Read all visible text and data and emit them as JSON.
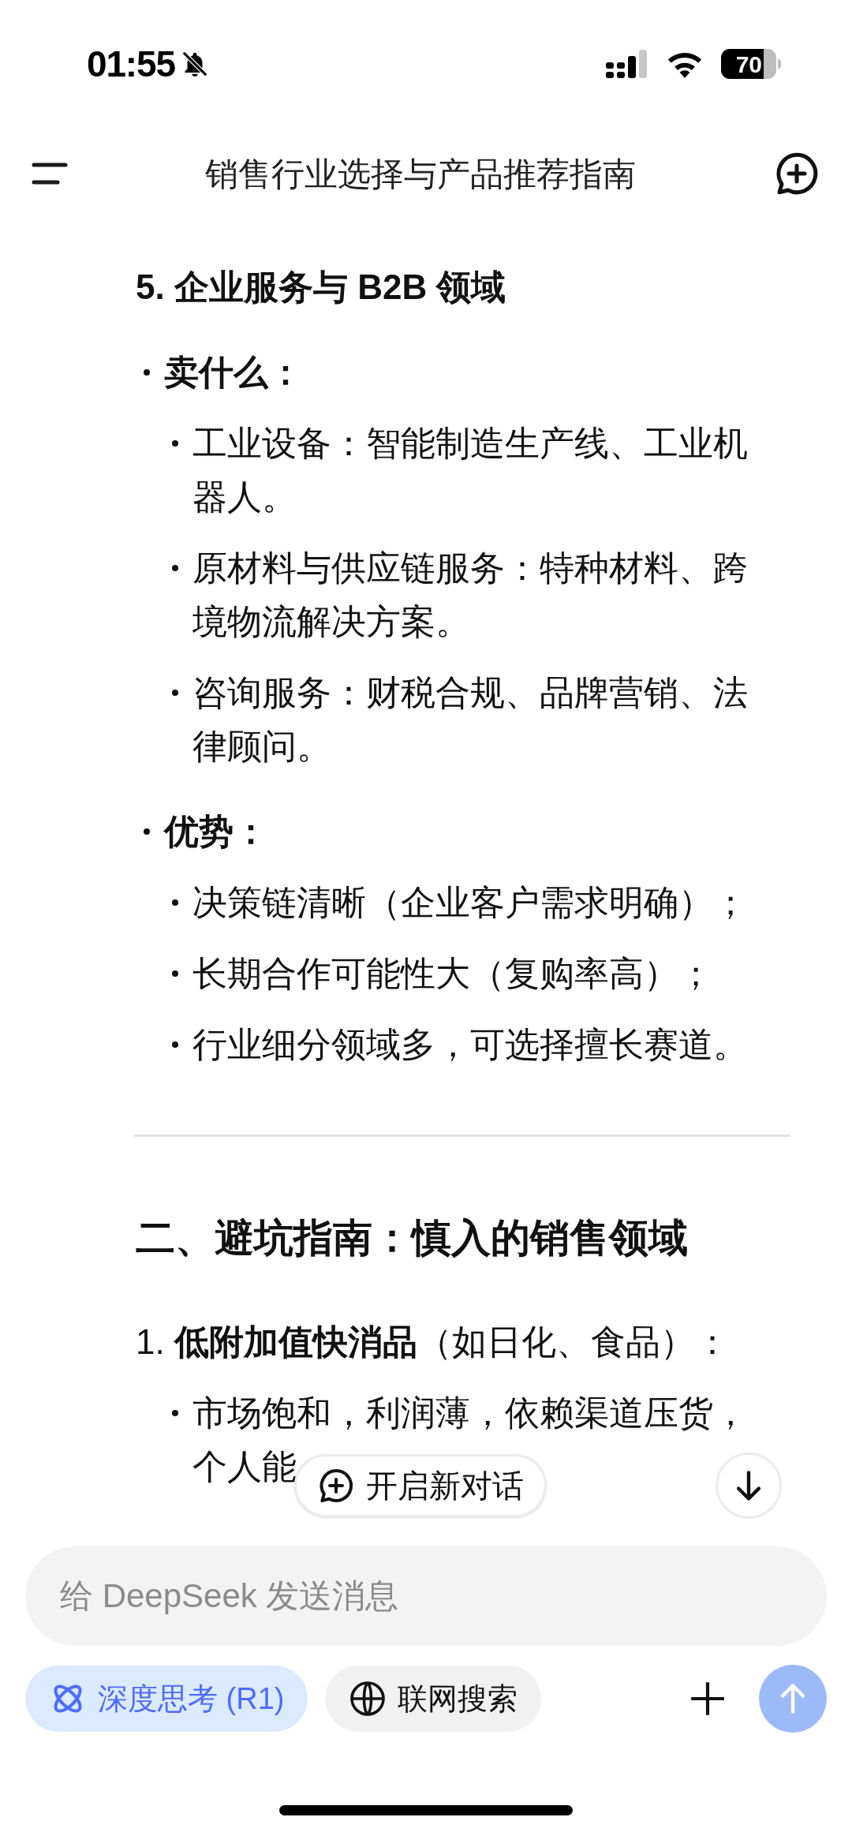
{
  "status_bar": {
    "time": "01:55",
    "battery": "70"
  },
  "header": {
    "title": "销售行业选择与产品推荐指南"
  },
  "article": [
    {
      "kind": "h3",
      "text": "5. 企业服务与 B2B 领域"
    },
    {
      "kind": "bullet",
      "text": "卖什么：",
      "children": [
        {
          "kind": "bullet",
          "text": "工业设备：智能制造生产线、工业机器人。"
        },
        {
          "kind": "bullet",
          "text": "原材料与供应链服务：特种材料、跨境物流解决方案。"
        },
        {
          "kind": "bullet",
          "text": "咨询服务：财税合规、品牌营销、法律顾问。"
        }
      ]
    },
    {
      "kind": "bullet",
      "text": "优势：",
      "children": [
        {
          "kind": "bullet",
          "text": "决策链清晰（企业客户需求明确）；"
        },
        {
          "kind": "bullet",
          "text": "长期合作可能性大（复购率高）；"
        },
        {
          "kind": "bullet",
          "text": "行业细分领域多，可选择擅长赛道。"
        }
      ]
    },
    {
      "kind": "divider"
    },
    {
      "kind": "h2",
      "text": "二、避坑指南：慎入的销售领域"
    },
    {
      "kind": "numbered",
      "text": "1. **低附加值快消品**（如日化、食品）：",
      "children": [
        {
          "kind": "bullet",
          "lines": [
            "市场饱和，利润薄，依赖渠道压货，",
            "个人能"
          ]
        }
      ]
    }
  ],
  "new_chat_button": {
    "label": "开启新对话"
  },
  "composer": {
    "placeholder": "给 DeepSeek 发送消息"
  },
  "toggles": [
    {
      "label": "深度思考 (R1)",
      "selected": true
    },
    {
      "label": "联网搜索",
      "selected": false
    }
  ]
}
